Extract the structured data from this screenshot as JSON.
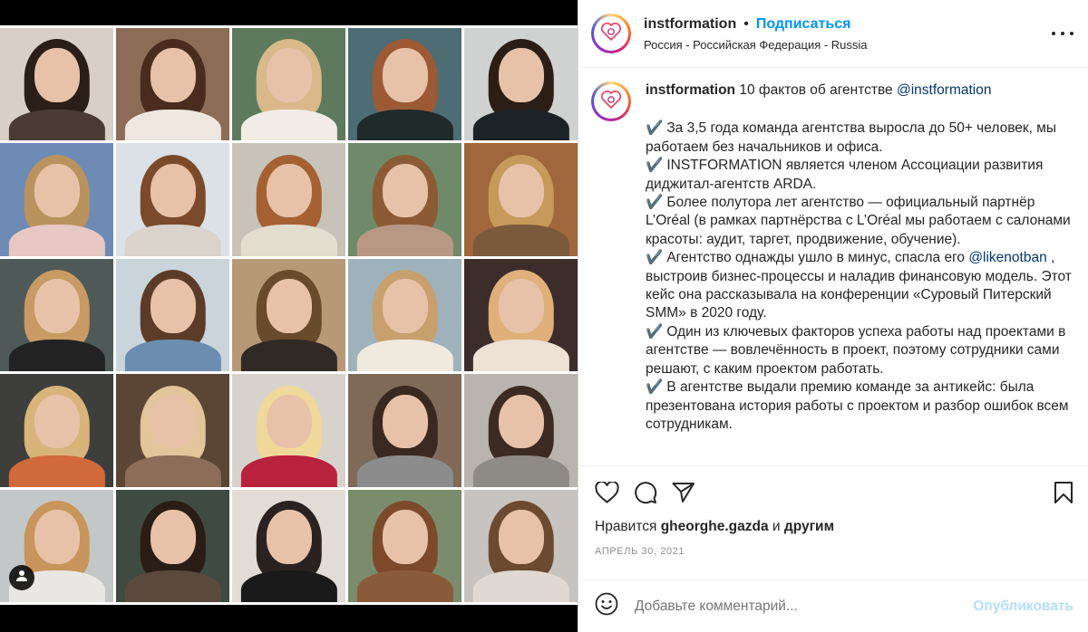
{
  "post": {
    "username": "instformation",
    "separator": "•",
    "follow_label": "Подписаться",
    "location": "Россия - Российская Федерация - Russia"
  },
  "caption": {
    "username": "instformation",
    "intro": "10 фактов об агентстве",
    "intro_mention": "@instformation",
    "check_glyph": "✔️",
    "facts": [
      {
        "text": "За 3,5 года команда агентства выросла до 50+ человек, мы работаем без начальников и офиса."
      },
      {
        "text": "INSTFORMATION является членом Ассоциации развития диджитал-агентств ARDA."
      },
      {
        "text": "Более полутора лет агентство — официальный партнёр L’Oréal (в рамках партнёрства с L’Oréal мы работаем с салонами красоты: аудит, таргет, продвижение, обучение)."
      },
      {
        "text_before": "Агентство однажды ушло в минус, спасла его",
        "mention": "@likenotban",
        "text_after": ", выстроив бизнес-процессы и наладив финансовую модель. Этот кейс она рассказывала на конференции «Суровый Питерский SMM» в 2020 году."
      },
      {
        "text": "Один из ключевых факторов успеха работы над проектами в агентстве — вовлечённость в проект, поэтому сотрудники сами решают, с каким проектом работать."
      },
      {
        "text": "В агентстве выдали премию команде за антикейс: была презентована история работы с проектом и разбор ошибок всем сотрудникам."
      }
    ]
  },
  "actions": {
    "like_icon": "heart-icon",
    "comment_icon": "comment-icon",
    "share_icon": "paper-plane-icon",
    "save_icon": "bookmark-icon"
  },
  "likes": {
    "prefix": "Нравится",
    "user": "gheorghe.gazda",
    "conj": "и",
    "others": "другим"
  },
  "date": "АПРЕЛЬ 30, 2021",
  "comment": {
    "placeholder": "Добавьте комментарий...",
    "publish_label": "Опубликовать",
    "emoji_icon": "smiley-icon"
  },
  "colors": {
    "accent_blue": "#0095f6",
    "publish_disabled": "#b2dffc",
    "mention": "#00376b",
    "muted": "#8e8e8e"
  },
  "media": {
    "user_tag_icon": "person-icon",
    "photos": [
      {
        "bg": "#d9cfc8",
        "hair": "#2b1d17",
        "body": "#4a3b36"
      },
      {
        "bg": "#8c6b57",
        "hair": "#4a2c1e",
        "body": "#efe6dd"
      },
      {
        "bg": "#5d7a5d",
        "hair": "#d9b98a",
        "body": "#f2ece6"
      },
      {
        "bg": "#4e6c73",
        "hair": "#9b5a34",
        "body": "#1f2a2b"
      },
      {
        "bg": "#cfd2d1",
        "hair": "#2a1e17",
        "body": "#1c2226"
      },
      {
        "bg": "#6d8bb5",
        "hair": "#b9935e",
        "body": "#e7c8c4"
      },
      {
        "bg": "#dbe1e6",
        "hair": "#7a4a2b",
        "body": "#d9d3cc"
      },
      {
        "bg": "#c8c3b8",
        "hair": "#a56134",
        "body": "#e3ddd0"
      },
      {
        "bg": "#6e8a6a",
        "hair": "#8c5b36",
        "body": "#b89885"
      },
      {
        "bg": "#a0673c",
        "hair": "#c59a5a",
        "body": "#7a5a3a"
      },
      {
        "bg": "#4f5a58",
        "hair": "#c79b63",
        "body": "#222"
      },
      {
        "bg": "#c9d4db",
        "hair": "#5c3b28",
        "body": "#6d8db0"
      },
      {
        "bg": "#b89977",
        "hair": "#6a4a2d",
        "body": "#2f2a26"
      },
      {
        "bg": "#9fb2bc",
        "hair": "#c7a06d",
        "body": "#efe9de"
      },
      {
        "bg": "#3c2d2b",
        "hair": "#e0b07a",
        "body": "#eee2d7"
      },
      {
        "bg": "#3e3f3d",
        "hair": "#d8b47a",
        "body": "#d06a3a"
      },
      {
        "bg": "#5b4636",
        "hair": "#e2c59a",
        "body": "#8c6d5a"
      },
      {
        "bg": "#d7d3cc",
        "hair": "#f0d79a",
        "body": "#b8223d"
      },
      {
        "bg": "#7f6a58",
        "hair": "#3a2920",
        "body": "#8c8c8c"
      },
      {
        "bg": "#b9b5ae",
        "hair": "#3c2b22",
        "body": "#8e8a85"
      },
      {
        "bg": "#c3c7c7",
        "hair": "#c8955c",
        "body": "#e9e7e4"
      },
      {
        "bg": "#3f4a42",
        "hair": "#2a1d16",
        "body": "#5a4a3e"
      },
      {
        "bg": "#e1dcd6",
        "hair": "#2a2220",
        "body": "#1a1a1a"
      },
      {
        "bg": "#7a8c6b",
        "hair": "#7c4a2b",
        "body": "#8a5b3a"
      },
      {
        "bg": "#c7c3c0",
        "hair": "#6b4a2f",
        "body": "#e0d8d2"
      }
    ]
  }
}
